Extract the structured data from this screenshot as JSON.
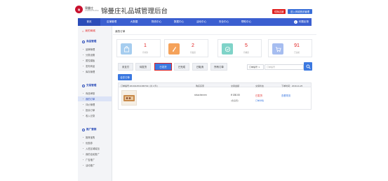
{
  "header": {
    "logo_mark": "锦",
    "logo_name": "锦曼庄",
    "logo_sub": "JINMANZHUANG",
    "system_title": "锦曼庄礼品城管理后台",
    "btn_red": "切换店铺",
    "btn_blue": "进入商城首页管理"
  },
  "nav": {
    "items": [
      "首页",
      "店铺管理",
      "大数据",
      "物流中心",
      "数据中心",
      "活动中心",
      "安全中心",
      "帮助中心"
    ],
    "right": "问题反馈",
    "active_index": 0
  },
  "sidebar": {
    "top": "我的商城",
    "sections": [
      {
        "title": "商品管理",
        "items": [
          "品牌管理",
          "分类设置",
          "属性模板",
          "发布商品",
          "库存管理"
        ]
      },
      {
        "title": "交易管理",
        "items": [
          "商品审核",
          "我的订单",
          "评价管理",
          "投诉订单",
          "收入记录"
        ]
      },
      {
        "title": "推广营销",
        "items": [
          "推荐宝购",
          "优惠券",
          "入驻区域增加",
          "我的全民推广",
          "广告推广",
          "活动推广"
        ]
      }
    ],
    "active_item": "我的订单"
  },
  "breadcrumb": "我的订单",
  "stats": [
    {
      "value": "1",
      "label": "待付款",
      "color": "#a6cdef",
      "icon": "bag-icon"
    },
    {
      "value": "2",
      "label": "待发货",
      "color": "#f5a25a",
      "icon": "clip-icon"
    },
    {
      "value": "5",
      "label": "待收货",
      "color": "#7fd3c8",
      "icon": "check-icon"
    },
    {
      "value": "91",
      "label": "已完成",
      "color": "#a6bdf0",
      "icon": "cart-icon"
    }
  ],
  "tabs": [
    "未支付",
    "待发货",
    "已发货",
    "已完成",
    "已取消",
    "所有订单"
  ],
  "active_tab": "已发货",
  "filter": {
    "select": "订单编号",
    "search_placeholder": "订单编号"
  },
  "merge_button": "合并订单",
  "order": {
    "header": {
      "order_no": "订单编号:2019112513180702 ( 共 1 件 )",
      "buyer_col": "购买买家",
      "amount_col": "交易金额",
      "status_col": "交易状态",
      "time": "下单时间：2019-11-25"
    },
    "buyer": "shiachenren",
    "price": "¥ 150.00",
    "shipping": "(含运费)",
    "status": "已发货",
    "status_link": "订单详情",
    "action": "查看物流"
  }
}
